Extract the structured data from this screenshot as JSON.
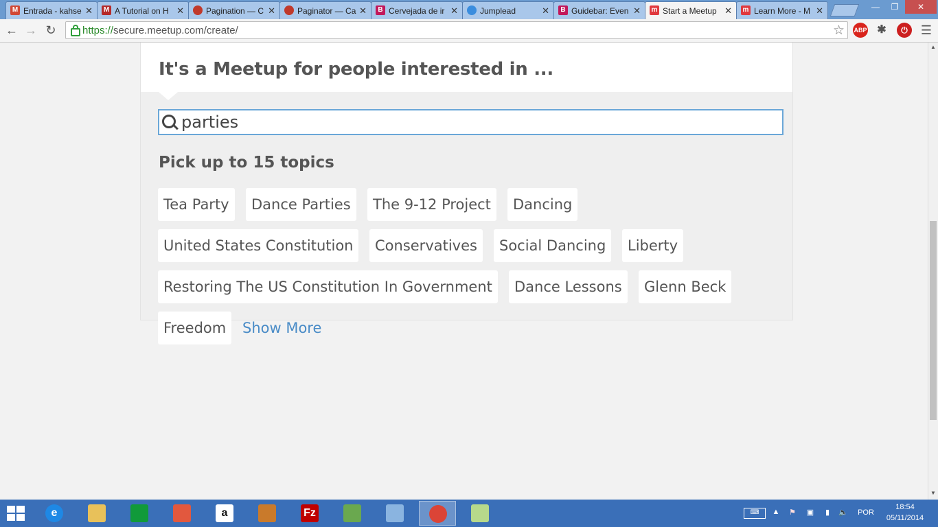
{
  "browser": {
    "tabs": [
      {
        "title": "Entrada - kahse",
        "favicon": "gmail-icon",
        "favicon_color": "#d14836",
        "favicon_text": "M"
      },
      {
        "title": "A Tutorial on H",
        "favicon": "m-icon",
        "favicon_color": "#b52a2a",
        "favicon_text": "M"
      },
      {
        "title": "Pagination — C",
        "favicon": "circle-icon",
        "favicon_color": "#c0392b",
        "favicon_text": ""
      },
      {
        "title": "Paginator — Ca",
        "favicon": "circle-icon",
        "favicon_color": "#c0392b",
        "favicon_text": ""
      },
      {
        "title": "Cervejada de ir",
        "favicon": "b-icon",
        "favicon_color": "#c2185b",
        "favicon_text": "B"
      },
      {
        "title": "Jumplead",
        "favicon": "globe-icon",
        "favicon_color": "#3a8dde",
        "favicon_text": ""
      },
      {
        "title": "Guidebar: Even",
        "favicon": "b-icon",
        "favicon_color": "#c2185b",
        "favicon_text": "B"
      },
      {
        "title": "Start a Meetup",
        "favicon": "meetup-icon",
        "favicon_color": "#e0393e",
        "favicon_text": "m"
      },
      {
        "title": "Learn More - M",
        "favicon": "meetup-icon",
        "favicon_color": "#e0393e",
        "favicon_text": "m"
      }
    ],
    "active_tab": 7,
    "url_scheme": "https://",
    "url_rest": "secure.meetup.com/create/",
    "extensions": [
      {
        "name": "adblock-plus-icon",
        "text": "ABP",
        "color": "#d9241c"
      },
      {
        "name": "puzzle-icon",
        "text": "",
        "color": "#555555"
      },
      {
        "name": "power-icon",
        "text": "",
        "color": "#cc1f1f"
      }
    ]
  },
  "page": {
    "heading": "It's a Meetup for people interested in ...",
    "search": {
      "value": "parties",
      "placeholder": ""
    },
    "pick_label": "Pick up to 15 topics",
    "topics": [
      "Tea Party",
      "Dance Parties",
      "The 9-12 Project",
      "Dancing",
      "United States Constitution",
      "Conservatives",
      "Social Dancing",
      "Liberty",
      "Restoring The US Constitution In Government",
      "Dance Lessons",
      "Glenn Beck",
      "Freedom"
    ],
    "show_more": "Show More",
    "link_color": "#4a8cc7"
  },
  "taskbar": {
    "apps": [
      {
        "name": "ie-icon",
        "label": "e",
        "color": "#1e88e5"
      },
      {
        "name": "explorer-icon",
        "label": "",
        "color": "#e8c15a"
      },
      {
        "name": "store-icon",
        "label": "",
        "color": "#119a3a"
      },
      {
        "name": "office-icon",
        "label": "",
        "color": "#e2583e"
      },
      {
        "name": "amazon-icon",
        "label": "a",
        "color": "#ffffff"
      },
      {
        "name": "media-icon",
        "label": "",
        "color": "#c97a2b"
      },
      {
        "name": "filezilla-icon",
        "label": "Fz",
        "color": "#bf0000"
      },
      {
        "name": "notepad-icon",
        "label": "",
        "color": "#6aa84f"
      },
      {
        "name": "box-icon",
        "label": "",
        "color": "#8ab4e0"
      },
      {
        "name": "chrome-icon",
        "label": "",
        "color": "#db4437"
      },
      {
        "name": "sticky-icon",
        "label": "",
        "color": "#b7d98b"
      }
    ],
    "active_app": 9,
    "language": "POR",
    "time": "18:54",
    "date": "05/11/2014"
  }
}
